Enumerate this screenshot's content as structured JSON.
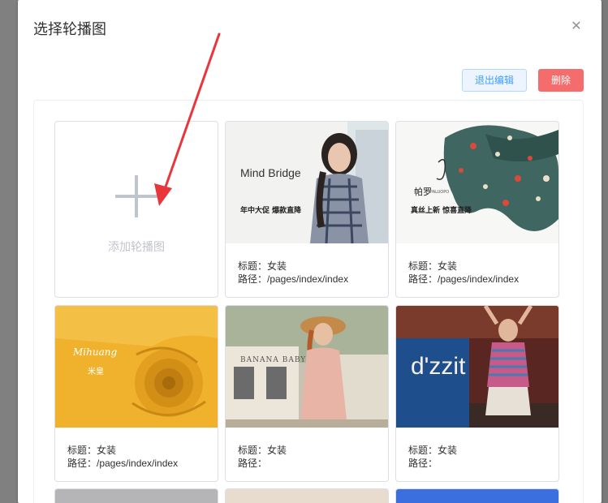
{
  "dialog": {
    "title": "选择轮播图",
    "close_icon": "close-icon"
  },
  "toolbar": {
    "exit_label": "退出编辑",
    "delete_label": "删除"
  },
  "add_card": {
    "label": "添加轮播图",
    "icon": "plus-icon"
  },
  "cards": [
    {
      "title_label": "标题：女装",
      "path_label": "路径：/pages/index/index",
      "brand": "Mind Bridge",
      "caption": "年中大促 爆款直降"
    },
    {
      "title_label": "标题：女装",
      "path_label": "路径：/pages/index/index",
      "brand": "帕罗",
      "brand_sub": "PALUOPO",
      "caption": "真丝上新 惊喜直降"
    },
    {
      "title_label": "标题：女装",
      "path_label": "路径：/pages/index/index",
      "brand": "Mihuang",
      "brand_cn": "米皇"
    },
    {
      "title_label": "标题：女装",
      "path_label": "路径：",
      "brand": "BANANA BABY"
    },
    {
      "title_label": "标题：女装",
      "path_label": "路径：",
      "brand": "d'zzit"
    }
  ],
  "colors": {
    "primary": "#409eff",
    "danger": "#f56c6c",
    "annotation_arrow": "#e8363b"
  }
}
